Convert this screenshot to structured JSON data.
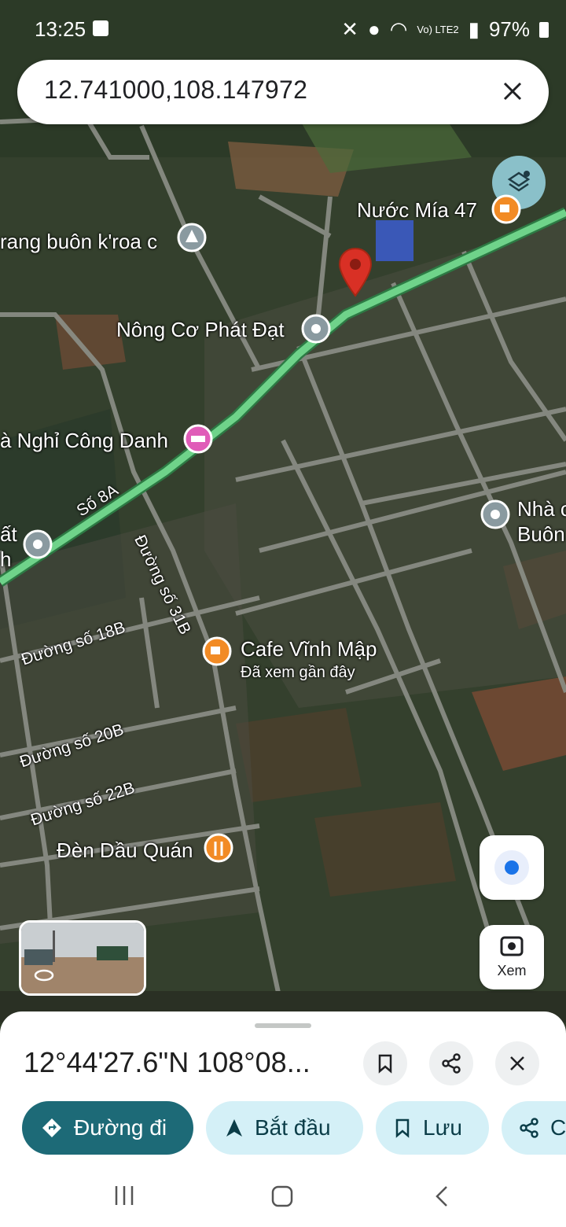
{
  "status_bar": {
    "time": "13:25",
    "network": "Vo) LTE2",
    "battery": "97%"
  },
  "search": {
    "query": "12.741000,108.147972"
  },
  "map": {
    "pois": {
      "nuoc_mia": "Nước Mía 47",
      "trang_buon": "rang buôn k'roa c",
      "nong_co": "Nông Cơ Phát Đạt",
      "nha_nghi": "à Nghỉ Công Danh",
      "cafe": "Cafe Vĩnh Mập",
      "cafe_sub": "Đã xem gần đây",
      "den_dau": "Đèn Dầu Quán",
      "nha_right_1": "Nhà c",
      "nha_right_2": "Buôn",
      "left_edge_1": "ất",
      "left_edge_2": "h"
    },
    "roads": {
      "so_8a": "Số 8A",
      "duong_31b": "Đường số 31B",
      "duong_18b": "Đường số 18B",
      "duong_20b": "Đường số 20B",
      "duong_22b": "Đường số 22B"
    },
    "lens_label": "Xem"
  },
  "place_sheet": {
    "title": "12°44'27.6\"N 108°08...",
    "actions": [
      {
        "label": "Đường đi",
        "icon": "directions-icon"
      },
      {
        "label": "Bắt đầu",
        "icon": "navigation-arrow-icon"
      },
      {
        "label": "Lưu",
        "icon": "bookmark-icon"
      },
      {
        "label": "C",
        "icon": "share-icon"
      }
    ]
  },
  "colors": {
    "primary_chip": "#1d6a77",
    "secondary_chip": "#d4f0f7",
    "route_green": "#6fd38a",
    "pin_red": "#d93025",
    "location_blue": "#1a73e8"
  }
}
